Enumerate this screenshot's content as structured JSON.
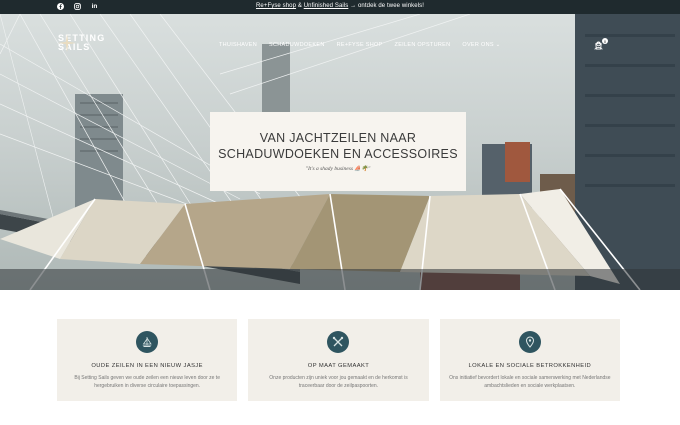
{
  "topbar": {
    "social": [
      "facebook-icon",
      "instagram-icon",
      "linkedin-icon"
    ],
    "announce_link1": "Re+Fyse shop",
    "announce_amp": "&",
    "announce_link2": "Unfinished Sails",
    "announce_rest": "→ ontdek de twee winkels!"
  },
  "header": {
    "logo_line1": "SETTING",
    "logo_line2": "SAILS",
    "nav": [
      "THUISHAVEN",
      "SCHADUWDOEKEN",
      "RE+FYSE SHOP",
      "ZEILEN OPSTUREN",
      "OVER ONS"
    ],
    "cart_count": "0"
  },
  "hero": {
    "title_line1": "VAN JACHTZEILEN NAAR",
    "title_line2": "SCHADUWDOEKEN EN ACCESSOIRES",
    "tagline": "\"It's a shady business ⛵🌴\""
  },
  "features": [
    {
      "icon": "sailboat-icon",
      "title": "OUDE ZEILEN IN EEN NIEUW JASJE",
      "desc": "Bij Setting Sails geven we oude zeilen een nieuw leven door ze te hergebruiken in diverse circulaire toepassingen."
    },
    {
      "icon": "tools-icon",
      "title": "OP MAAT GEMAAKT",
      "desc": "Onze producten zijn uniek voor jou gemaakt en de herkomst is traceerbaar door de zeilpaspoorten."
    },
    {
      "icon": "location-pin-icon",
      "title": "LOKALE EN SOCIALE BETROKKENHEID",
      "desc": "Ons initiatief bevordert lokale en sociale samenwerking met Nederlandse ambachtslieden en sociale werkplaatsen."
    }
  ],
  "colors": {
    "topbar": "#1f2a2e",
    "card_bg": "#f7f4ef",
    "feature_bg": "#f2efe9",
    "icon_bg": "#2f5560"
  }
}
